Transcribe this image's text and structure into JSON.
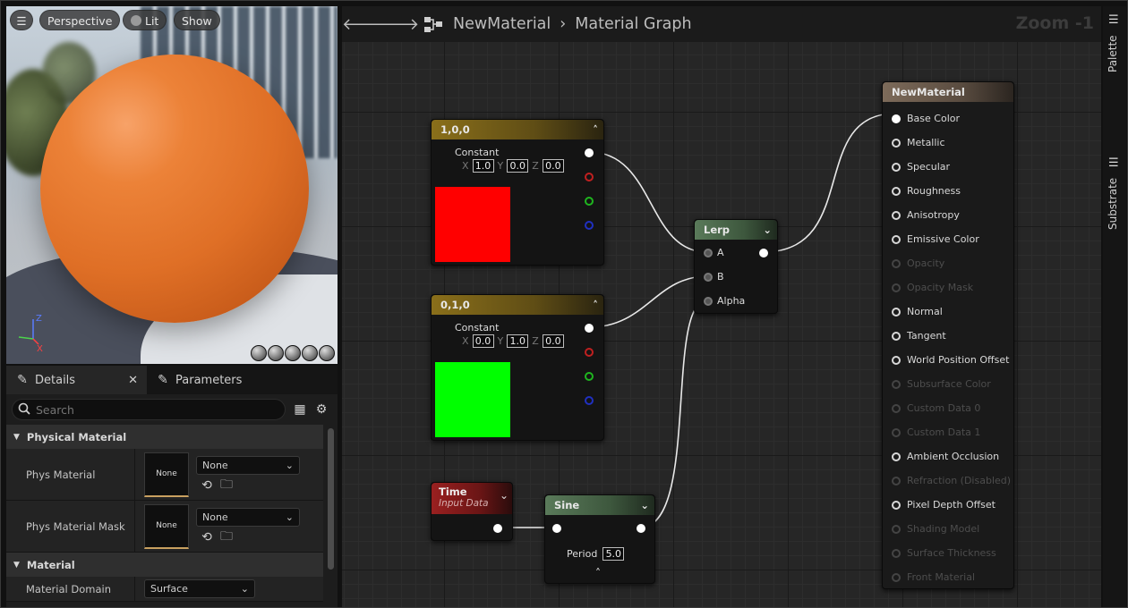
{
  "viewport": {
    "buttons": {
      "perspective": "Perspective",
      "lit": "Lit",
      "show": "Show"
    },
    "axes": {
      "z": "Z",
      "x": "X"
    }
  },
  "details": {
    "tabs": {
      "details": "Details",
      "parameters": "Parameters"
    },
    "search_placeholder": "Search",
    "categories": {
      "physical_material": "Physical Material",
      "material": "Material"
    },
    "phys_material": {
      "label": "Phys Material",
      "thumb": "None",
      "value": "None"
    },
    "phys_material_mask": {
      "label": "Phys Material Mask",
      "thumb": "None",
      "value": "None"
    },
    "material_domain": {
      "label": "Material Domain",
      "value": "Surface"
    }
  },
  "graph": {
    "breadcrumb": {
      "asset": "NewMaterial",
      "view": "Material Graph"
    },
    "zoom": "Zoom -1",
    "nodes": {
      "const_red": {
        "title": "1,0,0",
        "label": "Constant",
        "x": "1.0",
        "y": "0.0",
        "z": "0.0",
        "color": "#ff0000"
      },
      "const_green": {
        "title": "0,1,0",
        "label": "Constant",
        "x": "0.0",
        "y": "1.0",
        "z": "0.0",
        "color": "#00ff00"
      },
      "lerp": {
        "title": "Lerp",
        "a": "A",
        "b": "B",
        "alpha": "Alpha"
      },
      "time": {
        "title": "Time",
        "subtitle": "Input Data"
      },
      "sine": {
        "title": "Sine",
        "period_label": "Period",
        "period_value": "5.0"
      },
      "result": {
        "title": "NewMaterial",
        "pins": [
          {
            "label": "Base Color",
            "state": "connected"
          },
          {
            "label": "Metallic",
            "state": "active"
          },
          {
            "label": "Specular",
            "state": "active"
          },
          {
            "label": "Roughness",
            "state": "active"
          },
          {
            "label": "Anisotropy",
            "state": "active"
          },
          {
            "label": "Emissive Color",
            "state": "active"
          },
          {
            "label": "Opacity",
            "state": "disabled"
          },
          {
            "label": "Opacity Mask",
            "state": "disabled"
          },
          {
            "label": "Normal",
            "state": "active"
          },
          {
            "label": "Tangent",
            "state": "active"
          },
          {
            "label": "World Position Offset",
            "state": "active"
          },
          {
            "label": "Subsurface Color",
            "state": "disabled"
          },
          {
            "label": "Custom Data 0",
            "state": "disabled"
          },
          {
            "label": "Custom Data 1",
            "state": "disabled"
          },
          {
            "label": "Ambient Occlusion",
            "state": "active"
          },
          {
            "label": "Refraction (Disabled)",
            "state": "disabled"
          },
          {
            "label": "Pixel Depth Offset",
            "state": "active"
          },
          {
            "label": "Shading Model",
            "state": "disabled"
          },
          {
            "label": "Surface Thickness",
            "state": "disabled"
          },
          {
            "label": "Front Material",
            "state": "disabled"
          }
        ]
      }
    }
  },
  "side_panels": {
    "palette": "Palette",
    "substrate": "Substrate"
  }
}
